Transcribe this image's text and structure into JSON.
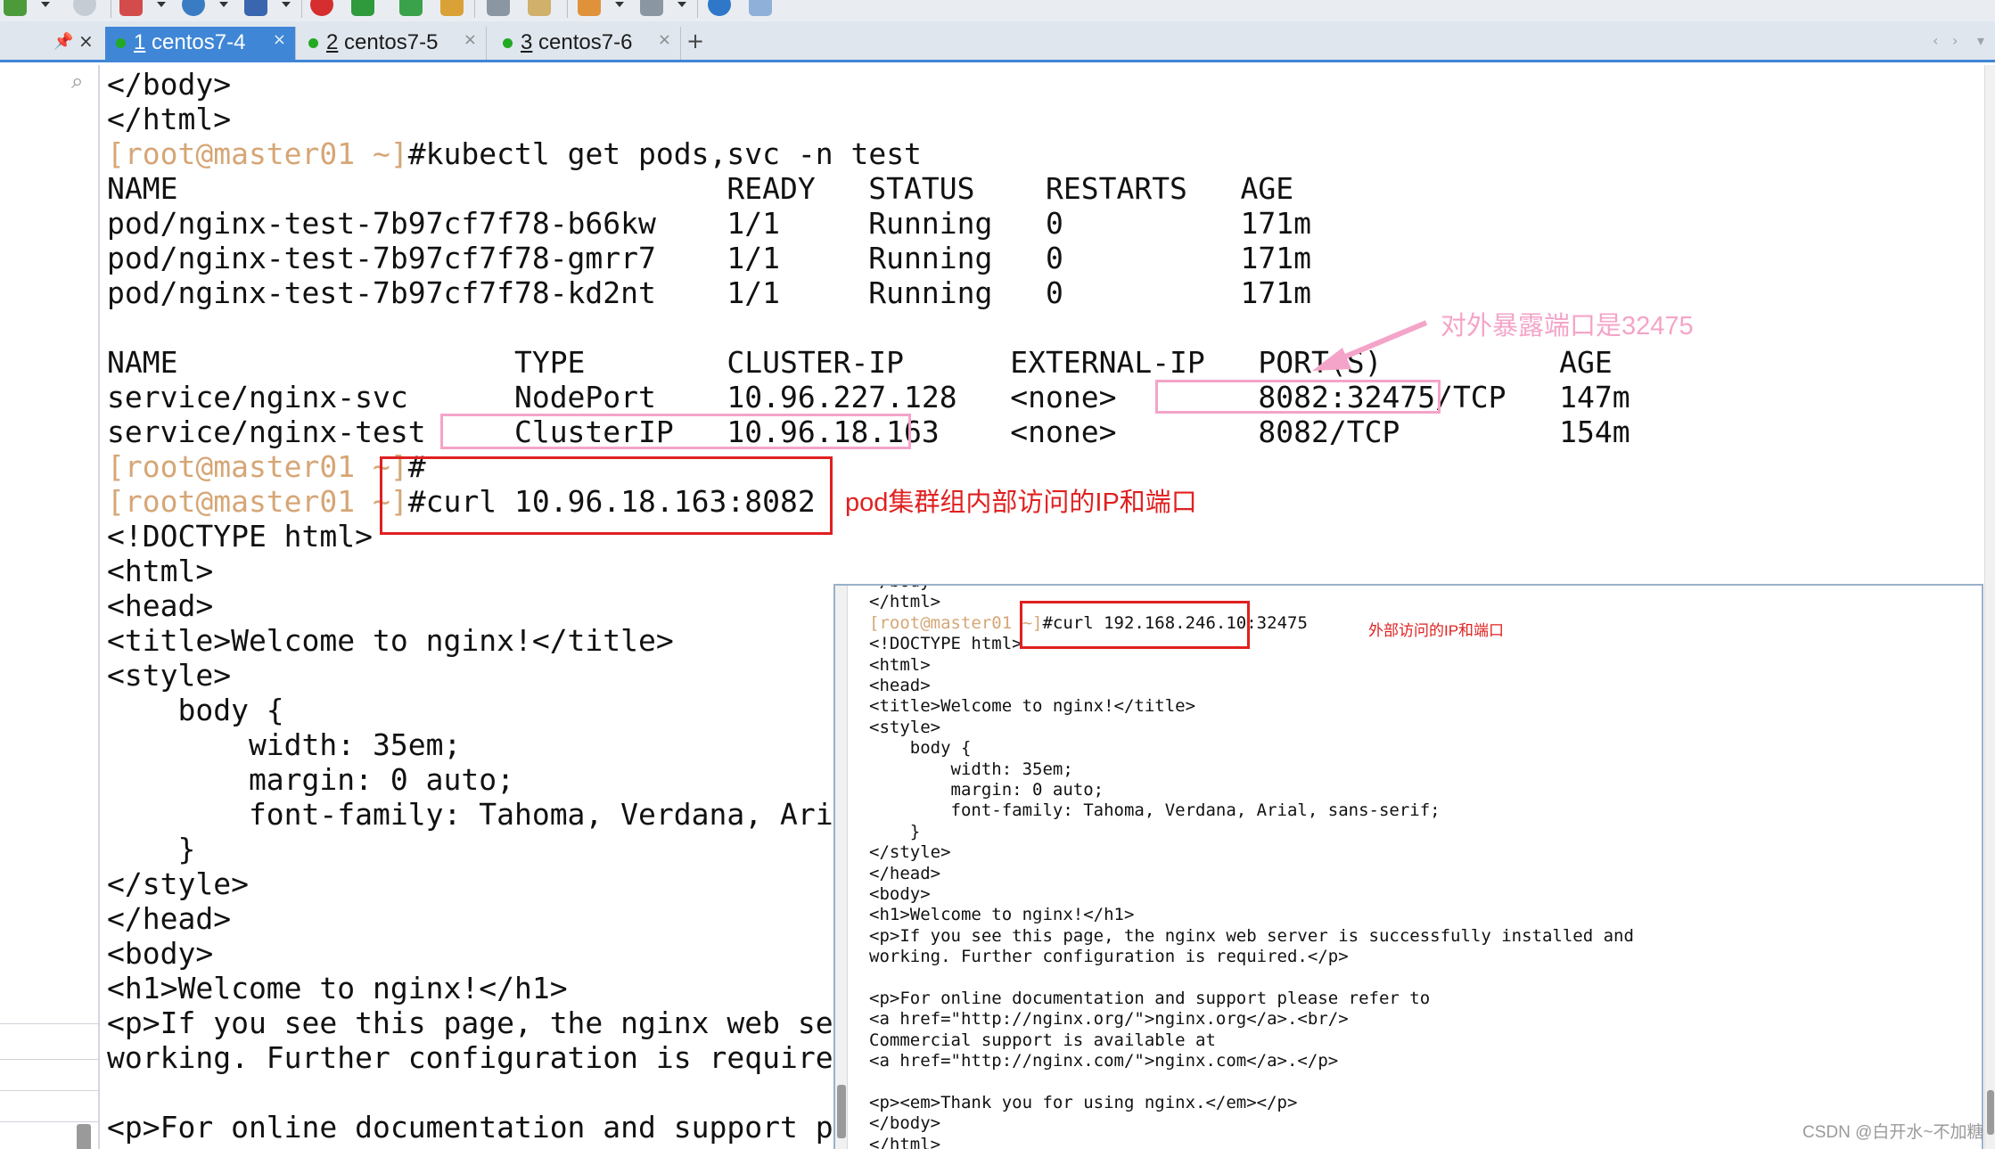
{
  "toolbar": {
    "icons": [
      "settings-icon",
      "search-icon",
      "layout-icon",
      "globe-icon",
      "font-icon",
      "record-icon",
      "script-icon",
      "resize-icon",
      "lock-icon",
      "keyboard-icon",
      "pen-icon",
      "add-icon",
      "windows-icon",
      "help-icon",
      "chat-icon"
    ]
  },
  "tabs": [
    {
      "number": "1",
      "name": " centos7-4",
      "close": "×",
      "active": true
    },
    {
      "number": "2",
      "name": " centos7-5",
      "close": "×",
      "active": false
    },
    {
      "number": "3",
      "name": " centos7-6",
      "close": "×",
      "active": false
    }
  ],
  "tabbar": {
    "new_tab": "+",
    "pin": "📌",
    "panel_close": "×"
  },
  "terminal": {
    "lines": [
      {
        "text": "</body>"
      },
      {
        "text": "</html>"
      },
      {
        "prompt": "[root@master01 ~]",
        "text": "#kubectl get pods,svc -n test"
      },
      {
        "text": "NAME                               READY   STATUS    RESTARTS   AGE"
      },
      {
        "text": "pod/nginx-test-7b97cf7f78-b66kw    1/1     Running   0          171m"
      },
      {
        "text": "pod/nginx-test-7b97cf7f78-gmrr7    1/1     Running   0          171m"
      },
      {
        "text": "pod/nginx-test-7b97cf7f78-kd2nt    1/1     Running   0          171m"
      },
      {
        "text": ""
      },
      {
        "text": "NAME                   TYPE        CLUSTER-IP      EXTERNAL-IP   PORT(S)          AGE"
      },
      {
        "text": "service/nginx-svc      NodePort    10.96.227.128   <none>        8082:32475/TCP   147m"
      },
      {
        "text": "service/nginx-test     ClusterIP   10.96.18.163    <none>        8082/TCP         154m"
      },
      {
        "prompt": "[root@master01 ~]",
        "text": "#"
      },
      {
        "prompt": "[root@master01 ~]",
        "text": "#curl 10.96.18.163:8082"
      },
      {
        "text": "<!DOCTYPE html>"
      },
      {
        "text": "<html>"
      },
      {
        "text": "<head>"
      },
      {
        "text": "<title>Welcome to nginx!</title>"
      },
      {
        "text": "<style>"
      },
      {
        "text": "    body {"
      },
      {
        "text": "        width: 35em;"
      },
      {
        "text": "        margin: 0 auto;"
      },
      {
        "text": "        font-family: Tahoma, Verdana, Arial"
      },
      {
        "text": "    }"
      },
      {
        "text": "</style>"
      },
      {
        "text": "</head>"
      },
      {
        "text": "<body>"
      },
      {
        "text": "<h1>Welcome to nginx!</h1>"
      },
      {
        "text": "<p>If you see this page, the nginx web serv"
      },
      {
        "text": "working. Further configuration is required."
      },
      {
        "text": ""
      },
      {
        "text": "<p>For online documentation and support ple"
      }
    ]
  },
  "annotations": {
    "nodeport_note": "对外暴露端口是32475",
    "cluster_note": "pod集群组内部访问的IP和端口",
    "external_note": "外部访问的IP和端口",
    "annotation_color": "#e02020",
    "nodeport_color": "#f4a4c8"
  },
  "overlay": {
    "lines": [
      {
        "text": "</body>"
      },
      {
        "text": "</html>"
      },
      {
        "prompt": "[root@master01 ~]",
        "text": "#curl 192.168.246.10:32475"
      },
      {
        "text": "<!DOCTYPE html>"
      },
      {
        "text": "<html>"
      },
      {
        "text": "<head>"
      },
      {
        "text": "<title>Welcome to nginx!</title>"
      },
      {
        "text": "<style>"
      },
      {
        "text": "    body {"
      },
      {
        "text": "        width: 35em;"
      },
      {
        "text": "        margin: 0 auto;"
      },
      {
        "text": "        font-family: Tahoma, Verdana, Arial, sans-serif;"
      },
      {
        "text": "    }"
      },
      {
        "text": "</style>"
      },
      {
        "text": "</head>"
      },
      {
        "text": "<body>"
      },
      {
        "text": "<h1>Welcome to nginx!</h1>"
      },
      {
        "text": "<p>If you see this page, the nginx web server is successfully installed and"
      },
      {
        "text": "working. Further configuration is required.</p>"
      },
      {
        "text": ""
      },
      {
        "text": "<p>For online documentation and support please refer to"
      },
      {
        "text": "<a href=\"http://nginx.org/\">nginx.org</a>.<br/>"
      },
      {
        "text": "Commercial support is available at"
      },
      {
        "text": "<a href=\"http://nginx.com/\">nginx.com</a>.</p>"
      },
      {
        "text": ""
      },
      {
        "text": "<p><em>Thank you for using nginx.</em></p>"
      },
      {
        "text": "</body>"
      },
      {
        "text": "</html>"
      }
    ]
  },
  "watermark": "CSDN @白开水~不加糖"
}
